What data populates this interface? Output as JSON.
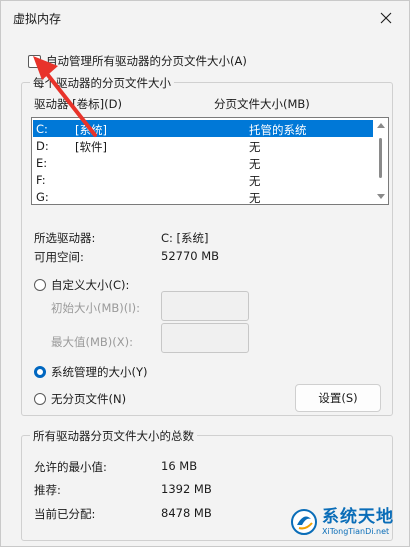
{
  "window": {
    "title": "虚拟内存"
  },
  "auto_manage": {
    "label": "自动管理所有驱动器的分页文件大小(A)",
    "checked": false
  },
  "group_drives": {
    "legend": "每个驱动器的分页文件大小",
    "columns": {
      "drive": "驱动器 [卷标](D)",
      "paging_size": "分页文件大小(MB)"
    },
    "rows": [
      {
        "drive": "C:",
        "label": "[系统]",
        "size": "托管的系统",
        "selected": true
      },
      {
        "drive": "D:",
        "label": "[软件]",
        "size": "无",
        "selected": false
      },
      {
        "drive": "E:",
        "label": "",
        "size": "无",
        "selected": false
      },
      {
        "drive": "F:",
        "label": "",
        "size": "无",
        "selected": false
      },
      {
        "drive": "G:",
        "label": "",
        "size": "无",
        "selected": false
      }
    ],
    "selected_drive_label": "所选驱动器:",
    "selected_drive_value": "C:  [系统]",
    "free_space_label": "可用空间:",
    "free_space_value": "52770 MB",
    "custom_size_label": "自定义大小(C):",
    "initial_size_label": "初始大小(MB)(I):",
    "max_size_label": "最大值(MB)(X):",
    "system_managed_label": "系统管理的大小(Y)",
    "no_paging_label": "无分页文件(N)",
    "selected_option": "system_managed",
    "set_button": "设置(S)"
  },
  "group_total": {
    "legend": "所有驱动器分页文件大小的总数",
    "min_label": "允许的最小值:",
    "min_value": "16 MB",
    "recommended_label": "推荐:",
    "recommended_value": "1392 MB",
    "current_label": "当前已分配:",
    "current_value": "8478 MB"
  },
  "watermark": {
    "cn": "系统天地",
    "en": "XiTongTianDi.net"
  },
  "colors": {
    "selection": "#0078d7",
    "radio_accent": "#0067c0",
    "arrow": "#e8332a",
    "watermark": "#0a6db8"
  }
}
